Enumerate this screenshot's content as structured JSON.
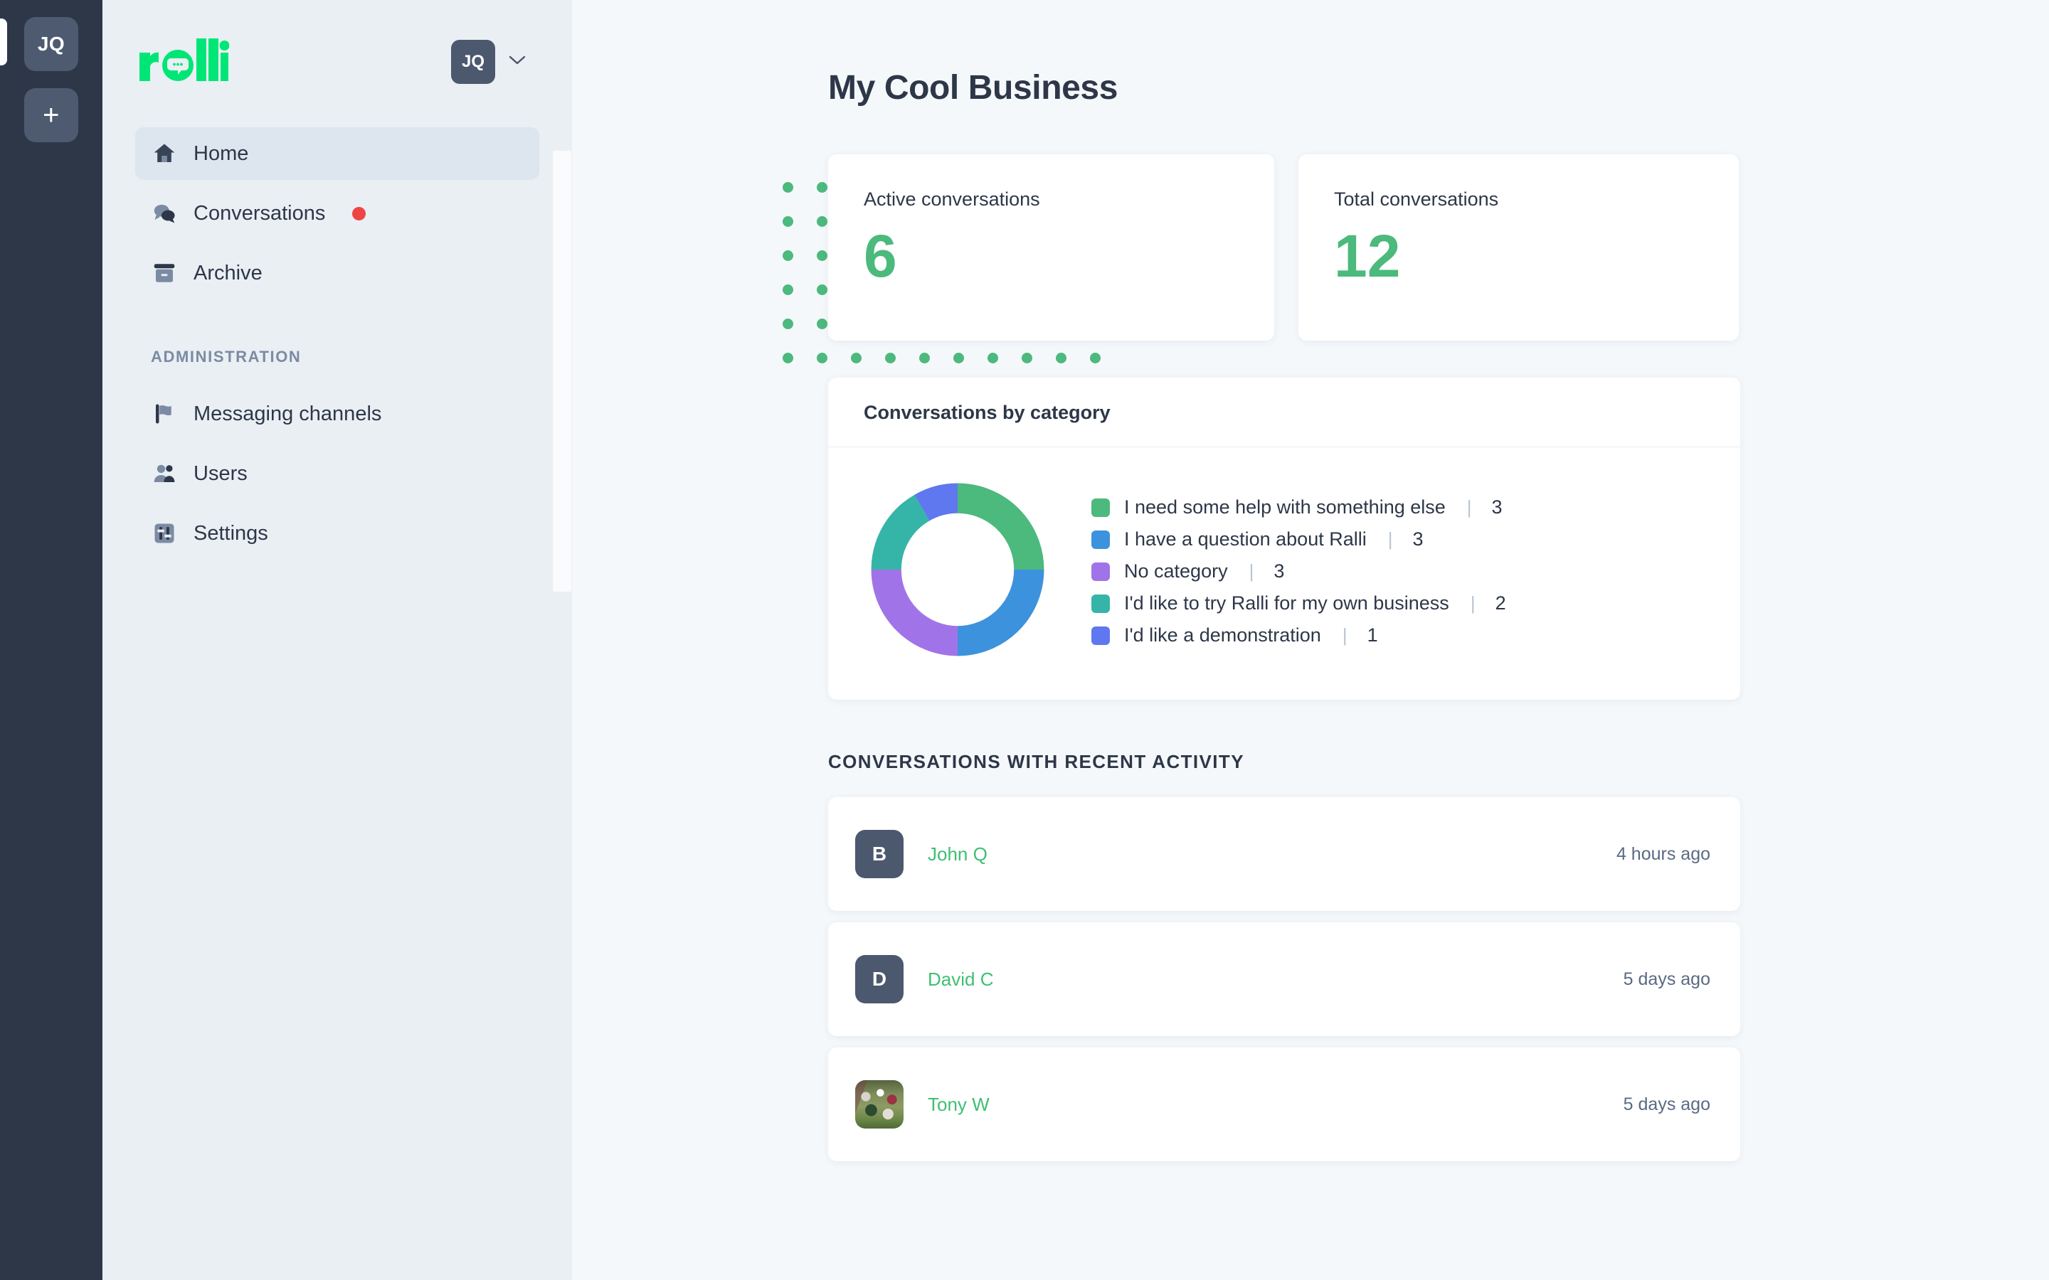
{
  "rail": {
    "account_tile_label": "JQ",
    "add_tile_label": "+"
  },
  "sidebar": {
    "logo_text": "ralli",
    "account": {
      "initials": "JQ"
    },
    "nav": [
      {
        "label": "Home",
        "icon": "home-icon",
        "active": true,
        "badge": false
      },
      {
        "label": "Conversations",
        "icon": "chat-icon",
        "active": false,
        "badge": true
      },
      {
        "label": "Archive",
        "icon": "archive-icon",
        "active": false,
        "badge": false
      }
    ],
    "section_title": "ADMINISTRATION",
    "admin_nav": [
      {
        "label": "Messaging channels",
        "icon": "flag-icon"
      },
      {
        "label": "Users",
        "icon": "users-icon"
      },
      {
        "label": "Settings",
        "icon": "sliders-icon"
      }
    ]
  },
  "main": {
    "page_title": "My Cool Business",
    "stats": [
      {
        "label": "Active conversations",
        "value": "6"
      },
      {
        "label": "Total conversations",
        "value": "12"
      }
    ],
    "category_card": {
      "title": "Conversations by category"
    },
    "recent": {
      "title": "CONVERSATIONS WITH RECENT ACTIVITY",
      "rows": [
        {
          "avatar": "B",
          "avatar_type": "initial",
          "name": "John Q",
          "time": "4 hours ago"
        },
        {
          "avatar": "D",
          "avatar_type": "initial",
          "name": "David C",
          "time": "5 days ago"
        },
        {
          "avatar": "",
          "avatar_type": "photo",
          "name": "Tony W",
          "time": "5 days ago"
        }
      ]
    }
  },
  "chart_data": {
    "type": "pie",
    "title": "Conversations by category",
    "donut": true,
    "legend_position": "right",
    "total": 12,
    "categories": [
      "I need some help with something else",
      "I have a question about Ralli",
      "No category",
      "I'd like to try Ralli for my own business",
      "I'd like a demonstration"
    ],
    "values": [
      3,
      3,
      3,
      2,
      1
    ],
    "colors": [
      "#4cb97d",
      "#3d92dd",
      "#a074e8",
      "#35b5a8",
      "#5f77ef"
    ]
  },
  "theme": {
    "brand_green": "#00e676",
    "accent_green": "#4cb97d",
    "text_dark": "#2d3748",
    "rail_bg": "#2d3748",
    "sidebar_bg": "#eaeff4",
    "badge_red": "#ef4444"
  }
}
